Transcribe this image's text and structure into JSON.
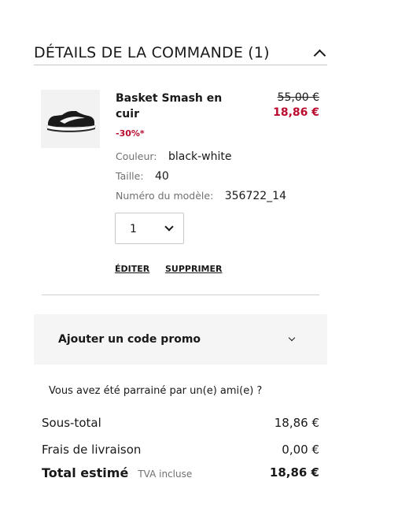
{
  "order": {
    "title": "DÉTAILS DE LA COMMANDE (1)"
  },
  "product": {
    "name": "Basket Smash en cuir",
    "discount": "-30%*",
    "old_price": "55,00 €",
    "new_price": "18,86 €",
    "color_label": "Couleur:",
    "color_value": "black-white",
    "size_label": "Taille:",
    "size_value": "40",
    "model_label": "Numéro du modèle:",
    "model_value": "356722_14",
    "quantity": "1",
    "edit_label": "ÉDITER",
    "remove_label": "SUPPRIMER",
    "image_icon": "sneaker-icon"
  },
  "promo": {
    "label": "Ajouter un code promo"
  },
  "referral": {
    "text": "Vous avez été parrainé par un(e) ami(e) ?"
  },
  "summary": {
    "subtotal_label": "Sous-total",
    "subtotal_value": "18,86 €",
    "shipping_label": "Frais de livraison",
    "shipping_value": "0,00 €",
    "total_label": "Total estimé",
    "tax_note": "TVA incluse",
    "total_value": "18,86 €"
  },
  "colors": {
    "sale_red": "#ba0c2f",
    "text": "#191919",
    "muted": "#707070",
    "promo_bg": "#f5f5f5"
  }
}
